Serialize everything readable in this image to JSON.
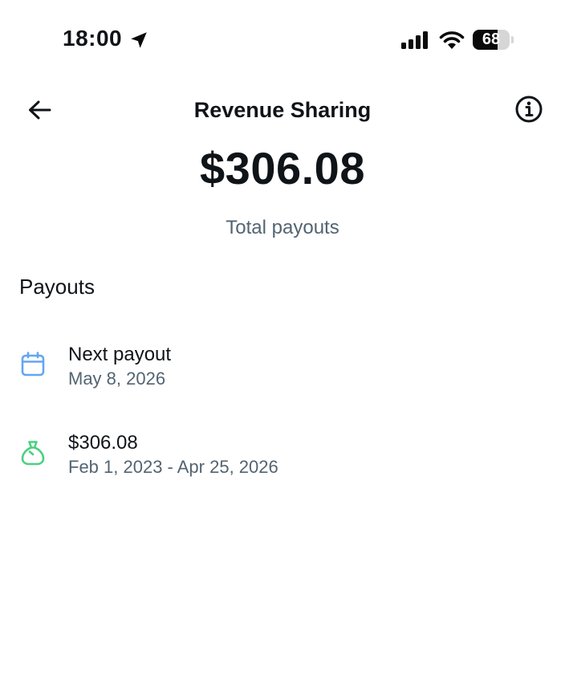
{
  "status_bar": {
    "time": "18:00",
    "battery_level": 68,
    "battery_text": "68",
    "location_icon": "location-arrow-icon",
    "signal_icon": "cellular-signal-icon",
    "wifi_icon": "wifi-icon"
  },
  "header": {
    "title": "Revenue Sharing",
    "back_icon": "back-arrow-icon",
    "info_icon": "info-icon"
  },
  "summary": {
    "amount": "$306.08",
    "label": "Total payouts"
  },
  "payouts": {
    "title": "Payouts",
    "items": [
      {
        "icon": "calendar-icon",
        "icon_color": "#64a6f0",
        "title": "Next payout",
        "subtitle": "May 8, 2026"
      },
      {
        "icon": "money-bag-icon",
        "icon_color": "#4cd080",
        "title": "$306.08",
        "subtitle": "Feb 1, 2023 - Apr 25, 2026"
      }
    ]
  },
  "colors": {
    "text_primary": "#0f1419",
    "text_secondary": "#536471",
    "background": "#ffffff"
  }
}
